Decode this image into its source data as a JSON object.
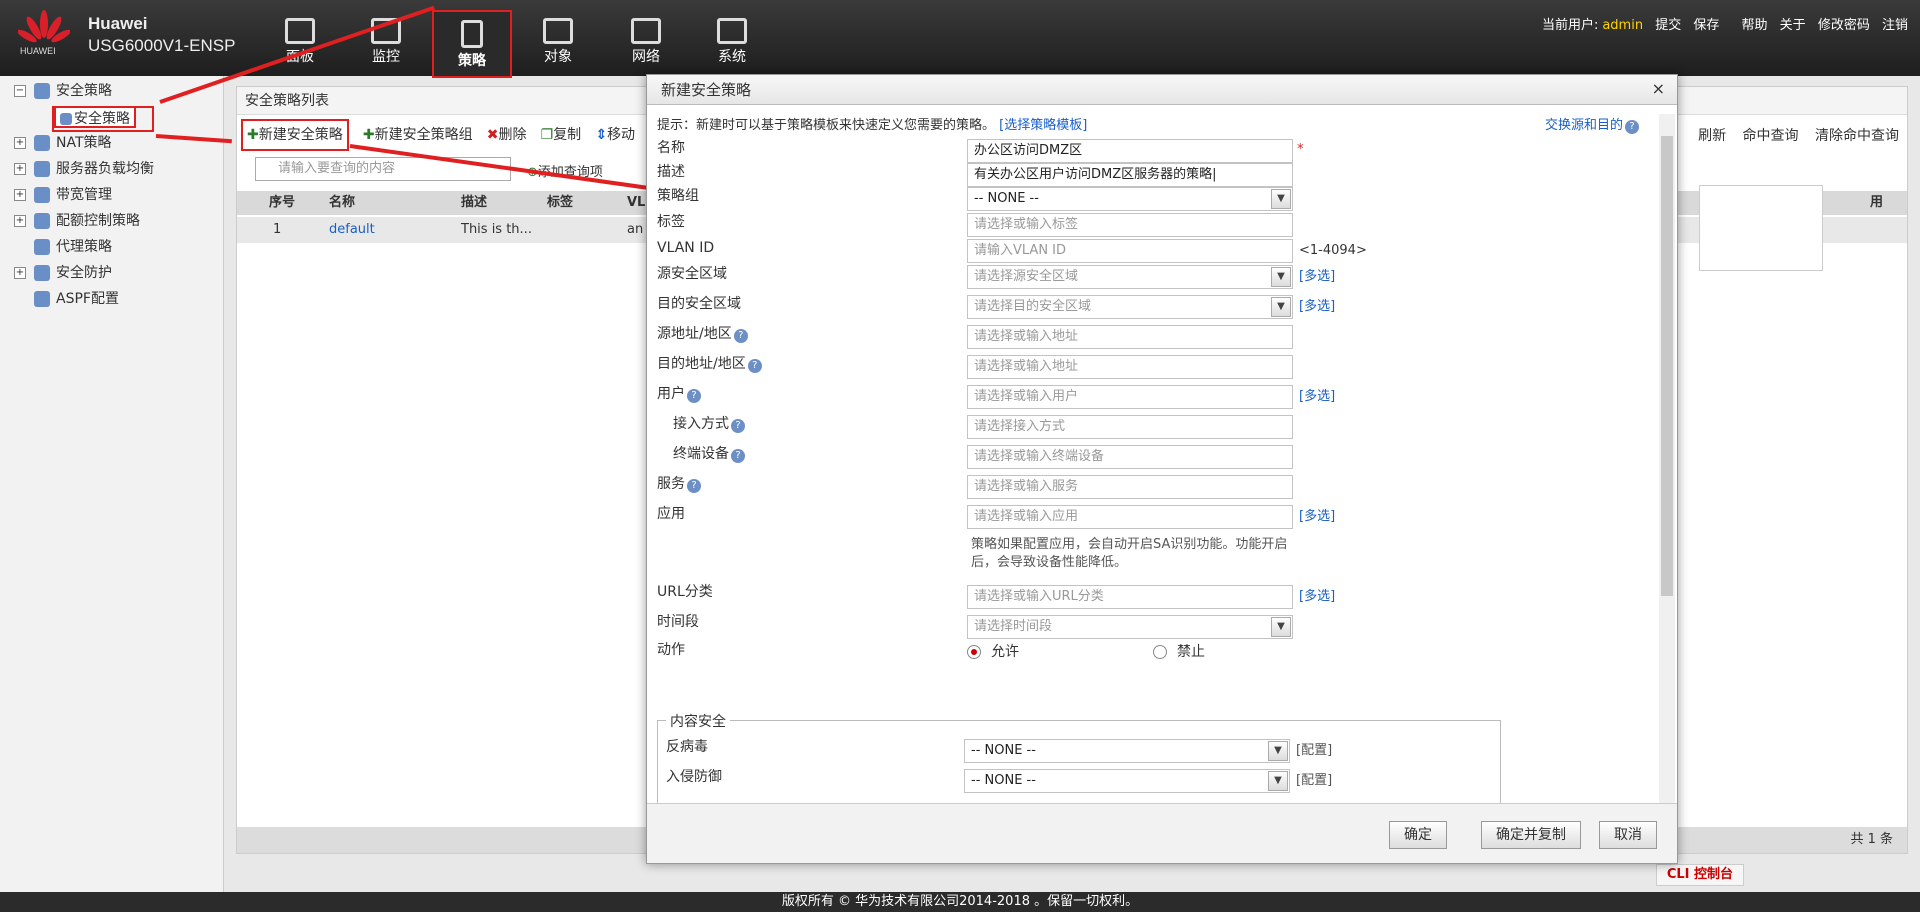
{
  "header": {
    "brand": "Huawei",
    "model": "USG6000V1-ENSP",
    "logo_text": "HUAWEI",
    "nav": [
      {
        "label": "面板"
      },
      {
        "label": "监控"
      },
      {
        "label": "策略"
      },
      {
        "label": "对象"
      },
      {
        "label": "网络"
      },
      {
        "label": "系统"
      }
    ],
    "user_label": "当前用户:",
    "user": "admin",
    "links": [
      "提交",
      "保存",
      "帮助",
      "关于",
      "修改密码",
      "注销"
    ]
  },
  "sidebar": {
    "items": [
      {
        "label": "安全策略"
      },
      {
        "label": "安全策略"
      },
      {
        "label": "NAT策略"
      },
      {
        "label": "服务器负载均衡"
      },
      {
        "label": "带宽管理"
      },
      {
        "label": "配额控制策略"
      },
      {
        "label": "代理策略"
      },
      {
        "label": "安全防护"
      },
      {
        "label": "ASPF配置"
      }
    ]
  },
  "main": {
    "title": "安全策略列表",
    "toolbar": [
      "新建安全策略",
      "新建安全策略组",
      "删除",
      "复制",
      "移动"
    ],
    "right_tools": [
      "刷新",
      "命中查询",
      "清除命中查询"
    ],
    "search_placeholder": "请输入要查询的内容",
    "add_query": "添加查询项",
    "columns": [
      "序号",
      "名称",
      "描述",
      "标签",
      "VL",
      "用"
    ],
    "row": {
      "no": "1",
      "name": "default",
      "desc": "This is th...",
      "tag": "",
      "vl": "an"
    },
    "pager": "共 1 条",
    "cli": "CLI 控制台"
  },
  "dialog": {
    "title": "新建安全策略",
    "close": "×",
    "hint": "提示：新建时可以基于策略模板来快速定义您需要的策略。",
    "hint_link": "[选择策略模板]",
    "swap": "交换源和目的",
    "fields": {
      "name_label": "名称",
      "name_value": "办公区访问DMZ区",
      "desc_label": "描述",
      "desc_value": "有关办公区用户访问DMZ区服务器的策略|",
      "group_label": "策略组",
      "group_value": "-- NONE --",
      "tag_label": "标签",
      "tag_ph": "请选择或输入标签",
      "vlan_label": "VLAN ID",
      "vlan_ph": "请输入VLAN ID",
      "vlan_range": "<1-4094>",
      "src_zone_label": "源安全区域",
      "src_zone_ph": "请选择源安全区域",
      "dst_zone_label": "目的安全区域",
      "dst_zone_ph": "请选择目的安全区域",
      "src_addr_label": "源地址/地区",
      "src_addr_ph": "请选择或输入地址",
      "dst_addr_label": "目的地址/地区",
      "dst_addr_ph": "请选择或输入地址",
      "user_label": "用户",
      "user_ph": "请选择或输入用户",
      "access_label": "接入方式",
      "access_ph": "请选择接入方式",
      "terminal_label": "终端设备",
      "terminal_ph": "请选择或输入终端设备",
      "service_label": "服务",
      "service_ph": "请选择或输入服务",
      "app_label": "应用",
      "app_ph": "请选择或输入应用",
      "app_note": "策略如果配置应用，会自动开启SA识别功能。功能开启后，会导致设备性能降低。",
      "url_label": "URL分类",
      "url_ph": "请选择或输入URL分类",
      "time_label": "时间段",
      "time_ph": "请选择时间段",
      "action_label": "动作",
      "allow": "允许",
      "deny": "禁止",
      "more": "[多选]"
    },
    "content_security": {
      "legend": "内容安全",
      "av_label": "反病毒",
      "av_value": "-- NONE --",
      "ips_label": "入侵防御",
      "ips_value": "-- NONE --",
      "config": "[配置]"
    },
    "buttons": {
      "ok": "确定",
      "ok_copy": "确定并复制",
      "cancel": "取消"
    }
  },
  "footer": "版权所有 © 华为技术有限公司2014-2018 。保留一切权利。",
  "colors": {
    "accent_red": "#e02020",
    "link": "#1a5fc8",
    "user": "#ffd200"
  }
}
